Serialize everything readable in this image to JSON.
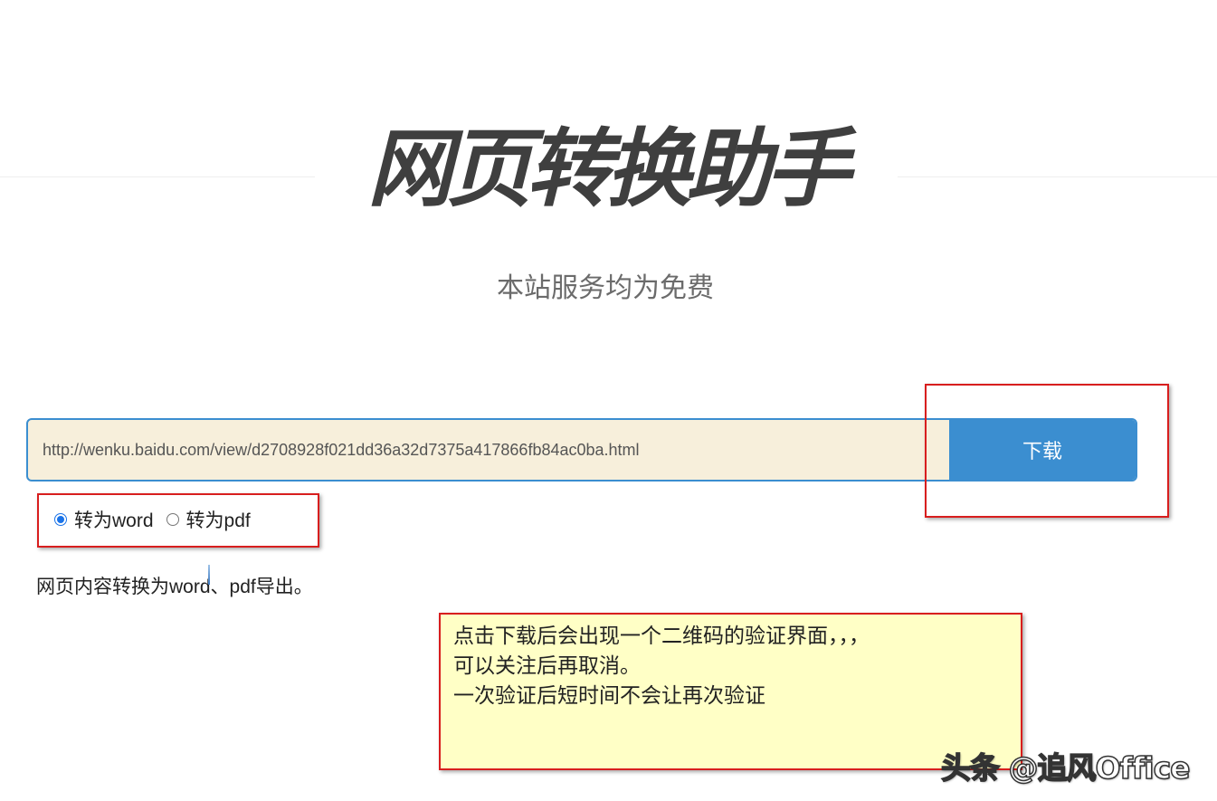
{
  "header": {
    "title": "网页转换助手",
    "subtitle": "本站服务均为免费"
  },
  "form": {
    "url_value": "http://wenku.baidu.com/view/d2708928f021dd36a32d7375a417866fb84ac0ba.html",
    "download_label": "下载",
    "options": [
      {
        "label": "转为word",
        "checked": true
      },
      {
        "label": "转为pdf",
        "checked": false
      }
    ],
    "description": "网页内容转换为word、pdf导出。"
  },
  "annotation": {
    "lines": [
      "点击下载后会出现一个二维码的验证界面，，，",
      "可以关注后再取消。",
      "一次验证后短时间不会让再次验证"
    ]
  },
  "watermark": {
    "text": "头条 @追风Office"
  },
  "colors": {
    "accent": "#3b8ed0",
    "input_bg": "#f7efdb",
    "highlight_border": "#d81e1e",
    "note_bg": "#ffffc6"
  }
}
